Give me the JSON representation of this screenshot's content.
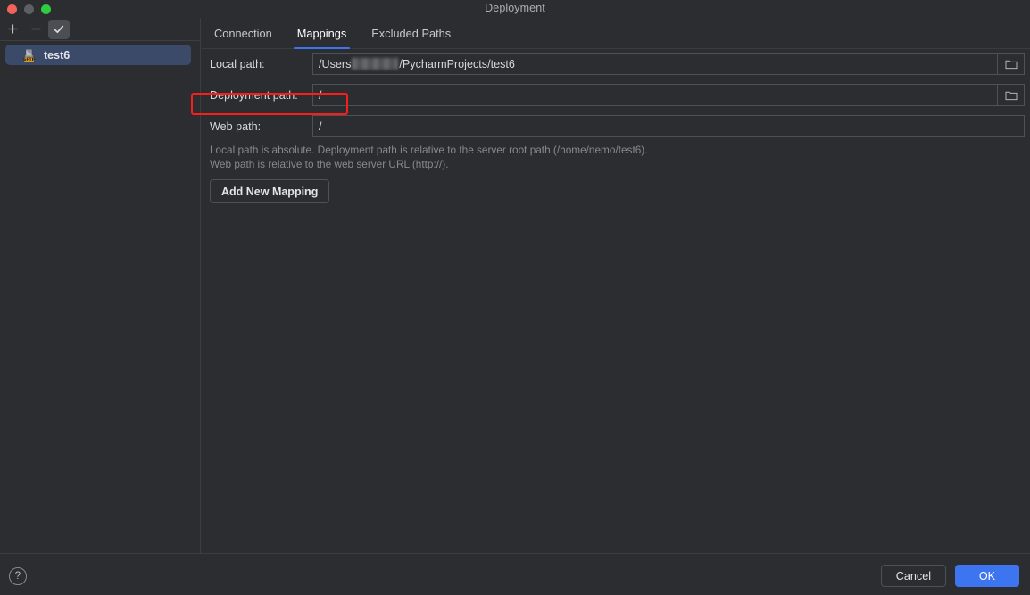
{
  "window": {
    "title": "Deployment",
    "traffic_lights": [
      "close-red",
      "minimize-grey",
      "zoom-green"
    ]
  },
  "sidebar": {
    "toolbar": [
      {
        "name": "add",
        "glyph": "+",
        "active": false
      },
      {
        "name": "remove",
        "glyph": "−",
        "active": false
      },
      {
        "name": "set-default",
        "glyph": "✓",
        "active": true
      }
    ],
    "servers": [
      {
        "label": "test6",
        "icon": "sftp-server-icon",
        "badge": "SFTP",
        "selected": true
      }
    ]
  },
  "main": {
    "tabs": [
      {
        "label": "Connection",
        "selected": false
      },
      {
        "label": "Mappings",
        "selected": true
      },
      {
        "label": "Excluded Paths",
        "selected": false
      }
    ],
    "fields": [
      {
        "label": "Local path:",
        "value_prefix": "/Users",
        "redacted": true,
        "value_suffix": "/PycharmProjects/test6",
        "has_browse": true,
        "browse_icon": "folder-icon"
      },
      {
        "label": "Deployment path:",
        "value": "/",
        "has_browse": true,
        "browse_icon": "folder-icon",
        "highlighted": true
      },
      {
        "label": "Web path:",
        "value": "/",
        "has_browse": false
      }
    ],
    "hint_line_1": "Local path is absolute. Deployment path is relative to the server root path (/home/nemo/test6).",
    "hint_line_2": "Web path is relative to the web server URL (http://).",
    "add_mapping_label": "Add New Mapping"
  },
  "footer": {
    "help_glyph": "?",
    "cancel_label": "Cancel",
    "ok_label": "OK"
  },
  "colors": {
    "background": "#2b2d30",
    "accent": "#3d74f0",
    "selection": "#3b4a69",
    "annotation": "#fb1d18",
    "hint_text": "#868a91"
  }
}
